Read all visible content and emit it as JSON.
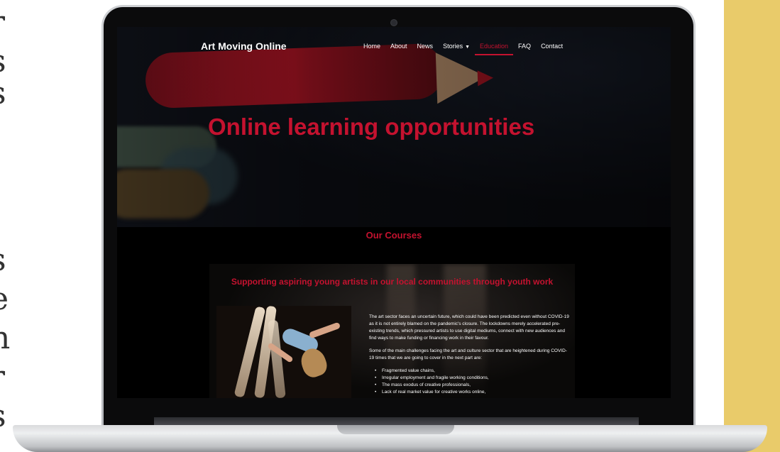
{
  "side_letters": [
    "r",
    "s",
    "s",
    "s",
    "e",
    "n",
    "r",
    "s"
  ],
  "navbar": {
    "brand": "Art Moving Online",
    "items": [
      {
        "label": "Home"
      },
      {
        "label": "About"
      },
      {
        "label": "News"
      },
      {
        "label": "Stories",
        "has_dropdown": true
      },
      {
        "label": "Education",
        "active": true
      },
      {
        "label": "FAQ"
      },
      {
        "label": "Contact"
      }
    ]
  },
  "hero": {
    "title": "Online learning opportunities"
  },
  "courses": {
    "section_title": "Our Courses",
    "card": {
      "title": "Supporting aspiring young artists in our local communities through youth work",
      "paragraph_1": "The art sector faces an uncertain future, which could have been predicted even without COVID-19 as it is not entirely blamed on the pandemic's closure. The lockdowns merely accelerated pre-existing trends, which pressured artists to use digital mediums, connect with new audiences and find ways to make funding or financing work in their favour.",
      "paragraph_2": "Some of the main challenges facing the art and culture sector that are heightened during COVID-19 times that we are going to cover in the next part are:",
      "bullets": [
        "Fragmented value chains,",
        "Irregular employment and fragile working conditions,",
        "The mass exodus of creative professionals,",
        "Lack of real market value for creative works online,"
      ]
    }
  },
  "colors": {
    "accent": "#c4122f",
    "side_panel": "#e9cb6a",
    "screen_bg": "#000000"
  }
}
